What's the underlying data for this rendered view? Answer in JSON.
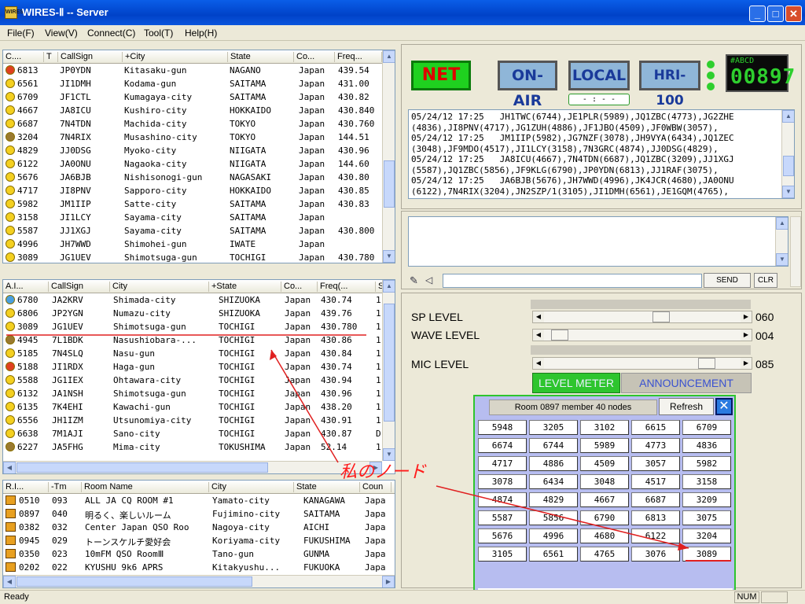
{
  "window": {
    "title": "WIRES-Ⅱ -- Server",
    "icon_label": "WIRES"
  },
  "menu": [
    "File(F)",
    "View(V)",
    "Connect(C)",
    "Tool(T)",
    "Help(H)"
  ],
  "top_list": {
    "headers": [
      "C....",
      "T",
      "CallSign",
      "+City",
      "State",
      "Co...",
      "Freq..."
    ],
    "rows": [
      {
        "icon": "red",
        "c": "6813",
        "call": "JP0YDN",
        "city": "Kitasaku-gun",
        "state": "NAGANO",
        "co": "Japan",
        "freq": "439.54"
      },
      {
        "icon": "yellow",
        "c": "6561",
        "call": "JI1DMH",
        "city": "Kodama-gun",
        "state": "SAITAMA",
        "co": "Japan",
        "freq": "431.00"
      },
      {
        "icon": "yellow",
        "c": "6709",
        "call": "JF1CTL",
        "city": "Kumagaya-city",
        "state": "SAITAMA",
        "co": "Japan",
        "freq": "430.82"
      },
      {
        "icon": "yellow",
        "c": "4667",
        "call": "JA8ICU",
        "city": "Kushiro-city",
        "state": "HOKKAIDO",
        "co": "Japan",
        "freq": "430.840"
      },
      {
        "icon": "yellow",
        "c": "6687",
        "call": "7N4TDN",
        "city": "Machida-city",
        "state": "TOKYO",
        "co": "Japan",
        "freq": "430.760"
      },
      {
        "icon": "brown",
        "c": "3204",
        "call": "7N4RIX",
        "city": "Musashino-city",
        "state": "TOKYO",
        "co": "Japan",
        "freq": "144.51"
      },
      {
        "icon": "yellow",
        "c": "4829",
        "call": "JJ0DSG",
        "city": "Myoko-city",
        "state": "NIIGATA",
        "co": "Japan",
        "freq": "430.96"
      },
      {
        "icon": "yellow",
        "c": "6122",
        "call": "JA0ONU",
        "city": "Nagaoka-city",
        "state": "NIIGATA",
        "co": "Japan",
        "freq": "144.60"
      },
      {
        "icon": "yellow",
        "c": "5676",
        "call": "JA6BJB",
        "city": "Nishisonogi-gun",
        "state": "NAGASAKI",
        "co": "Japan",
        "freq": "430.80"
      },
      {
        "icon": "yellow",
        "c": "4717",
        "call": "JI8PNV",
        "city": "Sapporo-city",
        "state": "HOKKAIDO",
        "co": "Japan",
        "freq": "430.85"
      },
      {
        "icon": "yellow",
        "c": "5982",
        "call": "JM1IIP",
        "city": "Satte-city",
        "state": "SAITAMA",
        "co": "Japan",
        "freq": "430.83"
      },
      {
        "icon": "yellow",
        "c": "3158",
        "call": "JI1LCY",
        "city": "Sayama-city",
        "state": "SAITAMA",
        "co": "Japan",
        "freq": ""
      },
      {
        "icon": "yellow",
        "c": "5587",
        "call": "JJ1XGJ",
        "city": "Sayama-city",
        "state": "SAITAMA",
        "co": "Japan",
        "freq": "430.800"
      },
      {
        "icon": "yellow",
        "c": "4996",
        "call": "JH7WWD",
        "city": "Shimohei-gun",
        "state": "IWATE",
        "co": "Japan",
        "freq": ""
      },
      {
        "icon": "yellow",
        "c": "3089",
        "call": "JG1UEV",
        "city": "Shimotsuga-gun",
        "state": "TOCHIGI",
        "co": "Japan",
        "freq": "430.780"
      }
    ]
  },
  "mid_list": {
    "headers": [
      "A.I...",
      "CallSign",
      "City",
      "+State",
      "Co...",
      "Freq(...",
      "S"
    ],
    "rows": [
      {
        "icon": "blue",
        "c": "6780",
        "call": "JA2KRV",
        "city": "Shimada-city",
        "state": "SHIZUOKA",
        "co": "Japan",
        "freq": "430.74",
        "s": "1"
      },
      {
        "icon": "yellow",
        "c": "6806",
        "call": "JP2YGN",
        "city": "Numazu-city",
        "state": "SHIZUOKA",
        "co": "Japan",
        "freq": "439.76",
        "s": "1"
      },
      {
        "icon": "yellow",
        "c": "3089",
        "call": "JG1UEV",
        "city": "Shimotsuga-gun",
        "state": "TOCHIGI",
        "co": "Japan",
        "freq": "430.780",
        "s": "1"
      },
      {
        "icon": "brown",
        "c": "4945",
        "call": "7L1BDK",
        "city": "Nasushiobara-...",
        "state": "TOCHIGI",
        "co": "Japan",
        "freq": "430.86",
        "s": "1"
      },
      {
        "icon": "yellow",
        "c": "5185",
        "call": "7N4SLQ",
        "city": "Nasu-gun",
        "state": "TOCHIGI",
        "co": "Japan",
        "freq": "430.84",
        "s": "1"
      },
      {
        "icon": "red",
        "c": "5188",
        "call": "JI1RDX",
        "city": "Haga-gun",
        "state": "TOCHIGI",
        "co": "Japan",
        "freq": "430.74",
        "s": "1"
      },
      {
        "icon": "yellow",
        "c": "5588",
        "call": "JG1IEX",
        "city": "Ohtawara-city",
        "state": "TOCHIGI",
        "co": "Japan",
        "freq": "430.94",
        "s": "1"
      },
      {
        "icon": "yellow",
        "c": "6132",
        "call": "JA1NSH",
        "city": "Shimotsuga-gun",
        "state": "TOCHIGI",
        "co": "Japan",
        "freq": "430.96",
        "s": "1"
      },
      {
        "icon": "yellow",
        "c": "6135",
        "call": "7K4EHI",
        "city": "Kawachi-gun",
        "state": "TOCHIGI",
        "co": "Japan",
        "freq": "438.20",
        "s": "1"
      },
      {
        "icon": "yellow",
        "c": "6556",
        "call": "JH1IZM",
        "city": "Utsunomiya-city",
        "state": "TOCHIGI",
        "co": "Japan",
        "freq": "430.91",
        "s": "1"
      },
      {
        "icon": "yellow",
        "c": "6638",
        "call": "7M1AJI",
        "city": "Sano-city",
        "state": "TOCHIGI",
        "co": "Japan",
        "freq": "430.87",
        "s": "D"
      },
      {
        "icon": "brown",
        "c": "6227",
        "call": "JA5FHG",
        "city": "Mima-city",
        "state": "TOKUSHIMA",
        "co": "Japan",
        "freq": "52.14",
        "s": "1"
      }
    ]
  },
  "room_list": {
    "headers": [
      "R.I...",
      "-Tm",
      "Room Name",
      "City",
      "State",
      "Coun"
    ],
    "rows": [
      {
        "id": "0510",
        "tm": "093",
        "name": "ALL JA CQ ROOM #1",
        "city": "Yamato-city",
        "state": "KANAGAWA",
        "co": "Japa"
      },
      {
        "id": "0897",
        "tm": "040",
        "name": "明るく、楽しいルーム",
        "city": "Fujimino-city",
        "state": "SAITAMA",
        "co": "Japa"
      },
      {
        "id": "0382",
        "tm": "032",
        "name": "Center Japan QSO Roo",
        "city": "Nagoya-city",
        "state": "AICHI",
        "co": "Japa"
      },
      {
        "id": "0945",
        "tm": "029",
        "name": "トーンスケルチ愛好会",
        "city": "Koriyama-city",
        "state": "FUKUSHIMA",
        "co": "Japa"
      },
      {
        "id": "0350",
        "tm": "023",
        "name": "10mFM QSO RoomⅢ",
        "city": "Tano-gun",
        "state": "GUNMA",
        "co": "Japa"
      },
      {
        "id": "0202",
        "tm": "022",
        "name": "KYUSHU 9k6 APRS",
        "city": "Kitakyushu...",
        "state": "FUKUOKA",
        "co": "Japa"
      }
    ]
  },
  "controls": {
    "net": "NET",
    "onair": "ON-AIR",
    "local": "LOCAL",
    "hri": "HRI-100",
    "counter_label": "#ABCD",
    "counter": "00897",
    "time_box": "- : - -"
  },
  "log_text": [
    "05/24/12 17:25   JH1TWC(6744),JE1PLR(5989),JQ1ZBC(4773),JG2ZHE",
    "(4836),JI8PNV(4717),JG1ZUH(4886),JF1JBO(4509),JF0WBW(3057),",
    "05/24/12 17:25   JM1IIP(5982),JG7NZF(3078),JH9VYA(6434),JQ1ZEC",
    "(3048),JF9MDO(4517),JI1LCY(3158),7N3GRC(4874),JJ0DSG(4829),",
    "05/24/12 17:25   JA8ICU(4667),7N4TDN(6687),JQ1ZBC(3209),JJ1XGJ",
    "(5587),JQ1ZBC(5856),JF9KLG(6790),JP0YDN(6813),JJ1RAF(3075),",
    "05/24/12 17:25   JA6BJB(5676),JH7WWD(4996),JK4JCR(4680),JA0ONU",
    "(6122),7N4RIX(3204),JN2SZP/1(3105),JI1DMH(6561),JE1GQM(4765),"
  ],
  "chat": {
    "send": "SEND",
    "clr": "CLR",
    "input_value": ""
  },
  "levels": {
    "sp_label": "SP LEVEL",
    "sp_value": "060",
    "sp_fraction": 0.6,
    "wave_label": "WAVE LEVEL",
    "wave_value": "004",
    "wave_fraction": 0.04,
    "mic_label": "MIC LEVEL",
    "mic_value": "085",
    "mic_fraction": 0.85,
    "level_meter": "LEVEL METER",
    "announcement": "ANNOUNCEMENT"
  },
  "room": {
    "info": "Room 0897 member 40 nodes",
    "refresh": "Refresh",
    "nodes": [
      "5948",
      "3205",
      "3102",
      "6615",
      "6709",
      "6674",
      "6744",
      "5989",
      "4773",
      "4836",
      "4717",
      "4886",
      "4509",
      "3057",
      "5982",
      "3078",
      "6434",
      "3048",
      "4517",
      "3158",
      "4874",
      "4829",
      "4667",
      "6687",
      "3209",
      "5587",
      "5856",
      "6790",
      "6813",
      "3075",
      "5676",
      "4996",
      "4680",
      "6122",
      "3204",
      "3105",
      "6561",
      "4765",
      "3076",
      "3089"
    ]
  },
  "annotation": {
    "text": "私のノード"
  },
  "status": {
    "left": "Ready",
    "num": "NUM"
  }
}
